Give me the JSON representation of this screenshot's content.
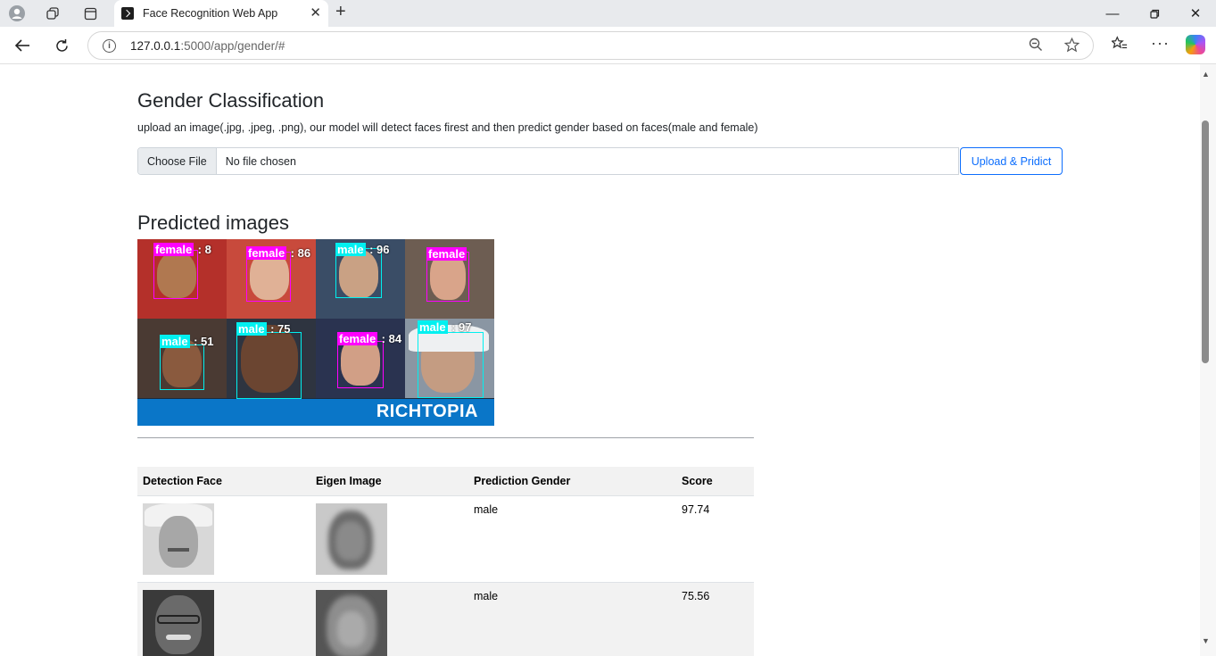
{
  "browser": {
    "tab_title": "Face Recognition Web App",
    "url_host": "127.0.0.1",
    "url_rest": ":5000/app/gender/#"
  },
  "page": {
    "title": "Gender Classification",
    "description": "upload an image(.jpg, .jpeg, .png), our model will detect faces firest and then predict gender based on faces(male and female)",
    "choose_file_label": "Choose File",
    "file_status": "No file chosen",
    "upload_button": "Upload & Pridict",
    "predicted_title": "Predicted images"
  },
  "predicted_image": {
    "banner": "RICHTOPIA",
    "labels": [
      {
        "gender": "female",
        "score": ": 8"
      },
      {
        "gender": "female",
        "score": ": 86"
      },
      {
        "gender": "male",
        "score": ": 96"
      },
      {
        "gender": "female",
        "score": ""
      },
      {
        "gender": "male",
        "score": ": 51"
      },
      {
        "gender": "male",
        "score": ": 75"
      },
      {
        "gender": "female",
        "score": ": 84"
      },
      {
        "gender": "male",
        "score": ": 97"
      }
    ],
    "colors": {
      "female": "#ff00ff",
      "male": "#00f0f0"
    }
  },
  "table": {
    "headers": [
      "Detection Face",
      "Eigen Image",
      "Prediction Gender",
      "Score"
    ],
    "rows": [
      {
        "gender": "male",
        "score": "97.74"
      },
      {
        "gender": "male",
        "score": "75.56"
      }
    ]
  }
}
